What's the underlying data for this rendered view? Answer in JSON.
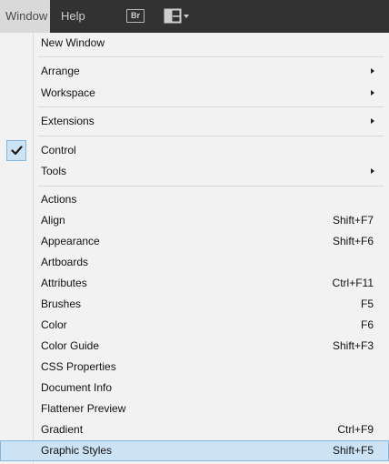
{
  "menubar": {
    "window_label": "Window",
    "help_label": "Help",
    "bridge_badge": "Br",
    "workspace_switcher_icon": "workspace-layout-icon",
    "dropdown_arrow_icon": "chevron-down-icon"
  },
  "menu": {
    "items": [
      {
        "label": "New Window"
      },
      {
        "label": "Arrange",
        "submenu": true
      },
      {
        "label": "Workspace",
        "submenu": true
      },
      {
        "label": "Extensions",
        "submenu": true
      },
      {
        "label": "Control",
        "checked": true
      },
      {
        "label": "Tools",
        "submenu": true
      },
      {
        "label": "Actions"
      },
      {
        "label": "Align",
        "shortcut": "Shift+F7"
      },
      {
        "label": "Appearance",
        "shortcut": "Shift+F6"
      },
      {
        "label": "Artboards"
      },
      {
        "label": "Attributes",
        "shortcut": "Ctrl+F11"
      },
      {
        "label": "Brushes",
        "shortcut": "F5"
      },
      {
        "label": "Color",
        "shortcut": "F6"
      },
      {
        "label": "Color Guide",
        "shortcut": "Shift+F3"
      },
      {
        "label": "CSS Properties"
      },
      {
        "label": "Document Info"
      },
      {
        "label": "Flattener Preview"
      },
      {
        "label": "Gradient",
        "shortcut": "Ctrl+F9"
      },
      {
        "label": "Graphic Styles",
        "shortcut": "Shift+F5",
        "selected": true
      }
    ]
  },
  "colors": {
    "menubar_bg": "#323232",
    "menu_bg": "#f2f2f2",
    "highlight": "#cce3f5",
    "highlight_border": "#86b6dc"
  }
}
